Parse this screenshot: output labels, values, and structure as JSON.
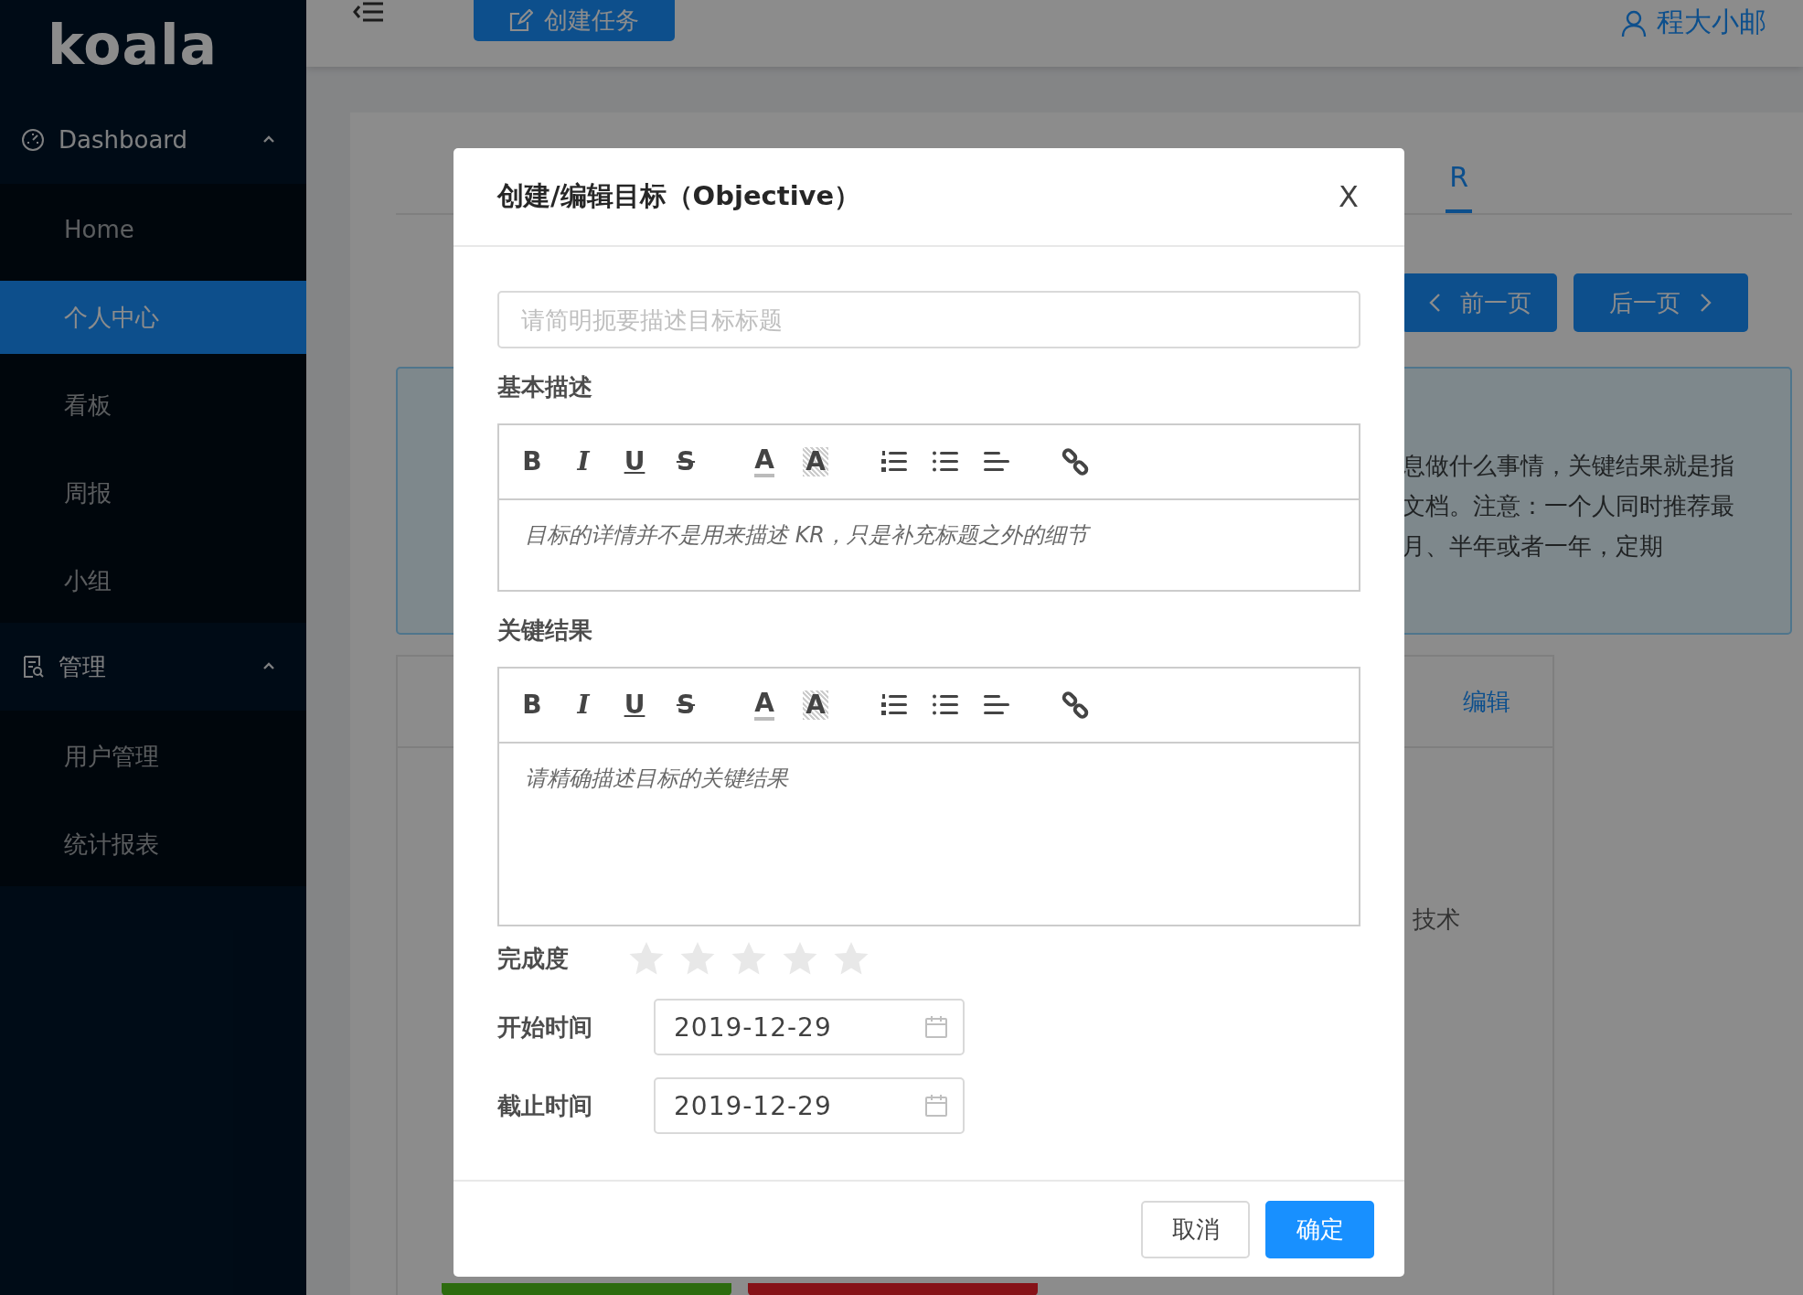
{
  "sidebar": {
    "logo": "koala",
    "groups": [
      {
        "label": "Dashboard",
        "kind": "dashboard",
        "expanded": true,
        "items": [
          {
            "label": "Home",
            "selected": false
          },
          {
            "label": "个人中心",
            "selected": true
          },
          {
            "label": "看板",
            "selected": false
          },
          {
            "label": "周报",
            "selected": false
          },
          {
            "label": "小组",
            "selected": false
          }
        ]
      },
      {
        "label": "管理",
        "kind": "manage",
        "expanded": true,
        "items": [
          {
            "label": "用户管理",
            "selected": false
          },
          {
            "label": "统计报表",
            "selected": false
          }
        ]
      }
    ]
  },
  "header": {
    "create_button": "创建任务",
    "user": "程大小邮"
  },
  "background": {
    "tabs": [
      {
        "label": "R",
        "selected": true
      }
    ],
    "pager": [
      {
        "label": "前一页",
        "kind": "prev"
      },
      {
        "label": "后一页",
        "kind": "next"
      }
    ],
    "notice_lines": [
      "息做什么事情，关键结果就是指",
      "文档。注意：一个人同时推荐最",
      "月、半年或者一年，定期"
    ],
    "edit_link": "编辑",
    "text": "技术"
  },
  "dialog": {
    "title": "创建/编辑目标（Objective）",
    "close": "X",
    "title_field": {
      "placeholder": "请简明扼要描述目标标题"
    },
    "sections": [
      {
        "label": "基本描述",
        "placeholder": "目标的详情并不是用来描述 KR，只是补充标题之外的细节",
        "toolbar": [
          {
            "kind": "bold",
            "glyph": "B"
          },
          {
            "kind": "italic",
            "glyph": "I"
          },
          {
            "kind": "underline",
            "glyph": "U"
          },
          {
            "kind": "strike",
            "glyph": "S"
          },
          {
            "kind": "color",
            "glyph": "A"
          },
          {
            "kind": "background",
            "glyph": "A"
          },
          {
            "kind": "ordered_list"
          },
          {
            "kind": "bullet_list"
          },
          {
            "kind": "align"
          },
          {
            "kind": "link"
          }
        ]
      },
      {
        "label": "关键结果",
        "placeholder": "请精确描述目标的关键结果",
        "toolbar": [
          {
            "kind": "bold",
            "glyph": "B"
          },
          {
            "kind": "italic",
            "glyph": "I"
          },
          {
            "kind": "underline",
            "glyph": "U"
          },
          {
            "kind": "strike",
            "glyph": "S"
          },
          {
            "kind": "color",
            "glyph": "A"
          },
          {
            "kind": "background",
            "glyph": "A"
          },
          {
            "kind": "ordered_list"
          },
          {
            "kind": "bullet_list"
          },
          {
            "kind": "align"
          },
          {
            "kind": "link"
          }
        ]
      }
    ],
    "completion": {
      "label": "完成度",
      "stars": 0
    },
    "dates": [
      {
        "label": "开始时间",
        "value": "2019-12-29"
      },
      {
        "label": "截止时间",
        "value": "2019-12-29"
      }
    ],
    "buttons": [
      {
        "label": "取消",
        "kind": "default"
      },
      {
        "label": "确定",
        "kind": "primary"
      }
    ]
  }
}
